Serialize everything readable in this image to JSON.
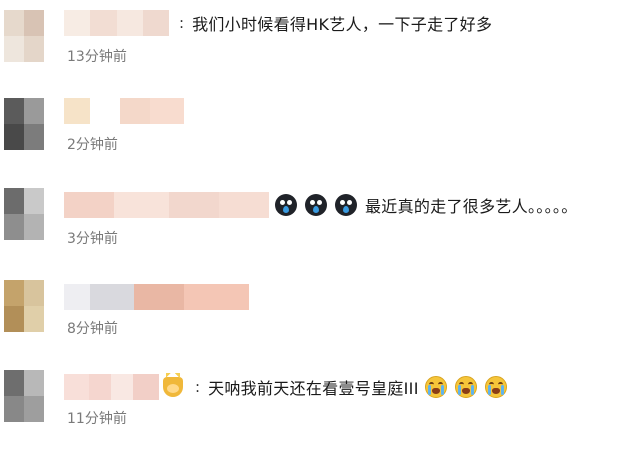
{
  "comments": [
    {
      "text": "我们小时候看得HK艺人，一下子走了好多",
      "time": "13分钟前",
      "avatar_colors": [
        "#e6d9cc",
        "#d8c3b4",
        "#eee6dd",
        "#e4d6c9"
      ],
      "name_colors": [
        "#f7ece4",
        "#f2ddd3",
        "#f6e8e0",
        "#efd9cf"
      ]
    },
    {
      "text": "",
      "time": "2分钟前",
      "avatar_colors": [
        "#5b5b5b",
        "#9a9a9a",
        "#494949",
        "#7c7c7c"
      ],
      "name_colors": [
        "#f6e3c8",
        "#ffffff",
        "#f4d8c9",
        "#f8dccf"
      ]
    },
    {
      "text": "最近真的走了很多艺人。。。。。",
      "time": "3分钟前",
      "avatar_colors": [
        "#6c6c6c",
        "#c9c9c9",
        "#8e8e8e",
        "#b3b3b3"
      ],
      "name_colors": [
        "#f3d2c6",
        "#f8e3da",
        "#f2d7cd",
        "#f6ddd3"
      ],
      "emojis": [
        "dark-cry-icon",
        "dark-cry-icon",
        "dark-cry-icon"
      ]
    },
    {
      "text": "",
      "time": "8分钟前",
      "avatar_colors": [
        "#c4a36b",
        "#d8c49d",
        "#b28f58",
        "#e0cfa9"
      ],
      "name_colors": [
        "#eeeef2",
        "#d9d9de",
        "#e9b7a4",
        "#f4c6b5"
      ]
    },
    {
      "text": "天呐我前天还在看壹号皇庭III",
      "time": "11分钟前",
      "avatar_colors": [
        "#6e6e6e",
        "#b8b8b8",
        "#888888",
        "#9e9e9e"
      ],
      "name_colors": [
        "#f8dfd9",
        "#f5d6cf",
        "#f9e8e3",
        "#f2cfc7"
      ],
      "badge": "crown-emoji",
      "emojis": [
        "crying-face-icon",
        "crying-face-icon",
        "crying-face-icon"
      ]
    }
  ]
}
